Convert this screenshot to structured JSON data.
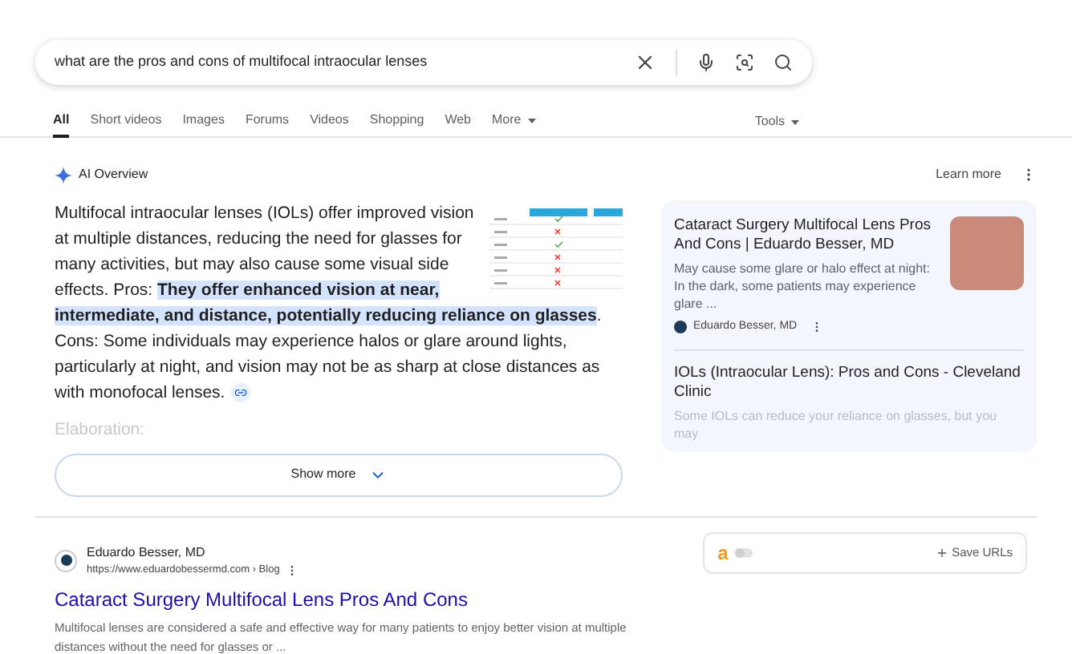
{
  "search": {
    "value": "what are the pros and cons of multifocal intraocular lenses"
  },
  "tabs": [
    {
      "label": "All",
      "selected": true
    },
    {
      "label": "Short videos",
      "selected": false
    },
    {
      "label": "Images",
      "selected": false
    },
    {
      "label": "Forums",
      "selected": false
    },
    {
      "label": "Videos",
      "selected": false
    },
    {
      "label": "Shopping",
      "selected": false
    },
    {
      "label": "Web",
      "selected": false
    },
    {
      "label": "More",
      "selected": false
    }
  ],
  "tools": "Tools",
  "ai_overview": {
    "title": "AI Overview",
    "learn_more": "Learn more",
    "paragraph": {
      "before": "Multifocal intraocular lenses (IOLs) offer improved vision at multiple distances, reducing the need for glasses for many activities, but may also cause some visual side effects. Pros: ",
      "highlight": "They offer enhanced vision at near, intermediate, and distance, potentially reducing reliance on glasses",
      "after": ". Cons: Some individuals may experience halos or glare around lights, particularly at night, and vision may not be as sharp at close distances as with monofocal lenses."
    },
    "elaboration": "Elaboration:",
    "show_more": "Show more",
    "sources": [
      {
        "title": "Cataract Surgery Multifocal Lens Pros And Cons | Eduardo Besser, MD",
        "snippet": "May cause some glare or halo effect at night: In the dark, some patients may experience glare ...",
        "site": "Eduardo Besser, MD"
      },
      {
        "title": "IOLs (Intraocular Lens): Pros and Cons - Cleveland Clinic",
        "snippet": "Some IOLs can reduce your reliance on glasses, but you may"
      }
    ]
  },
  "result": {
    "site": "Eduardo Besser, MD",
    "url": "https://www.eduardobessermd.com › Blog",
    "title": "Cataract Surgery Multifocal Lens Pros And Cons",
    "snippet": "Multifocal lenses are considered a safe and effective way for many patients to enjoy better vision at multiple distances without the need for glasses or ..."
  },
  "extension": {
    "logo": "a",
    "on": false,
    "save": "Save URLs"
  }
}
